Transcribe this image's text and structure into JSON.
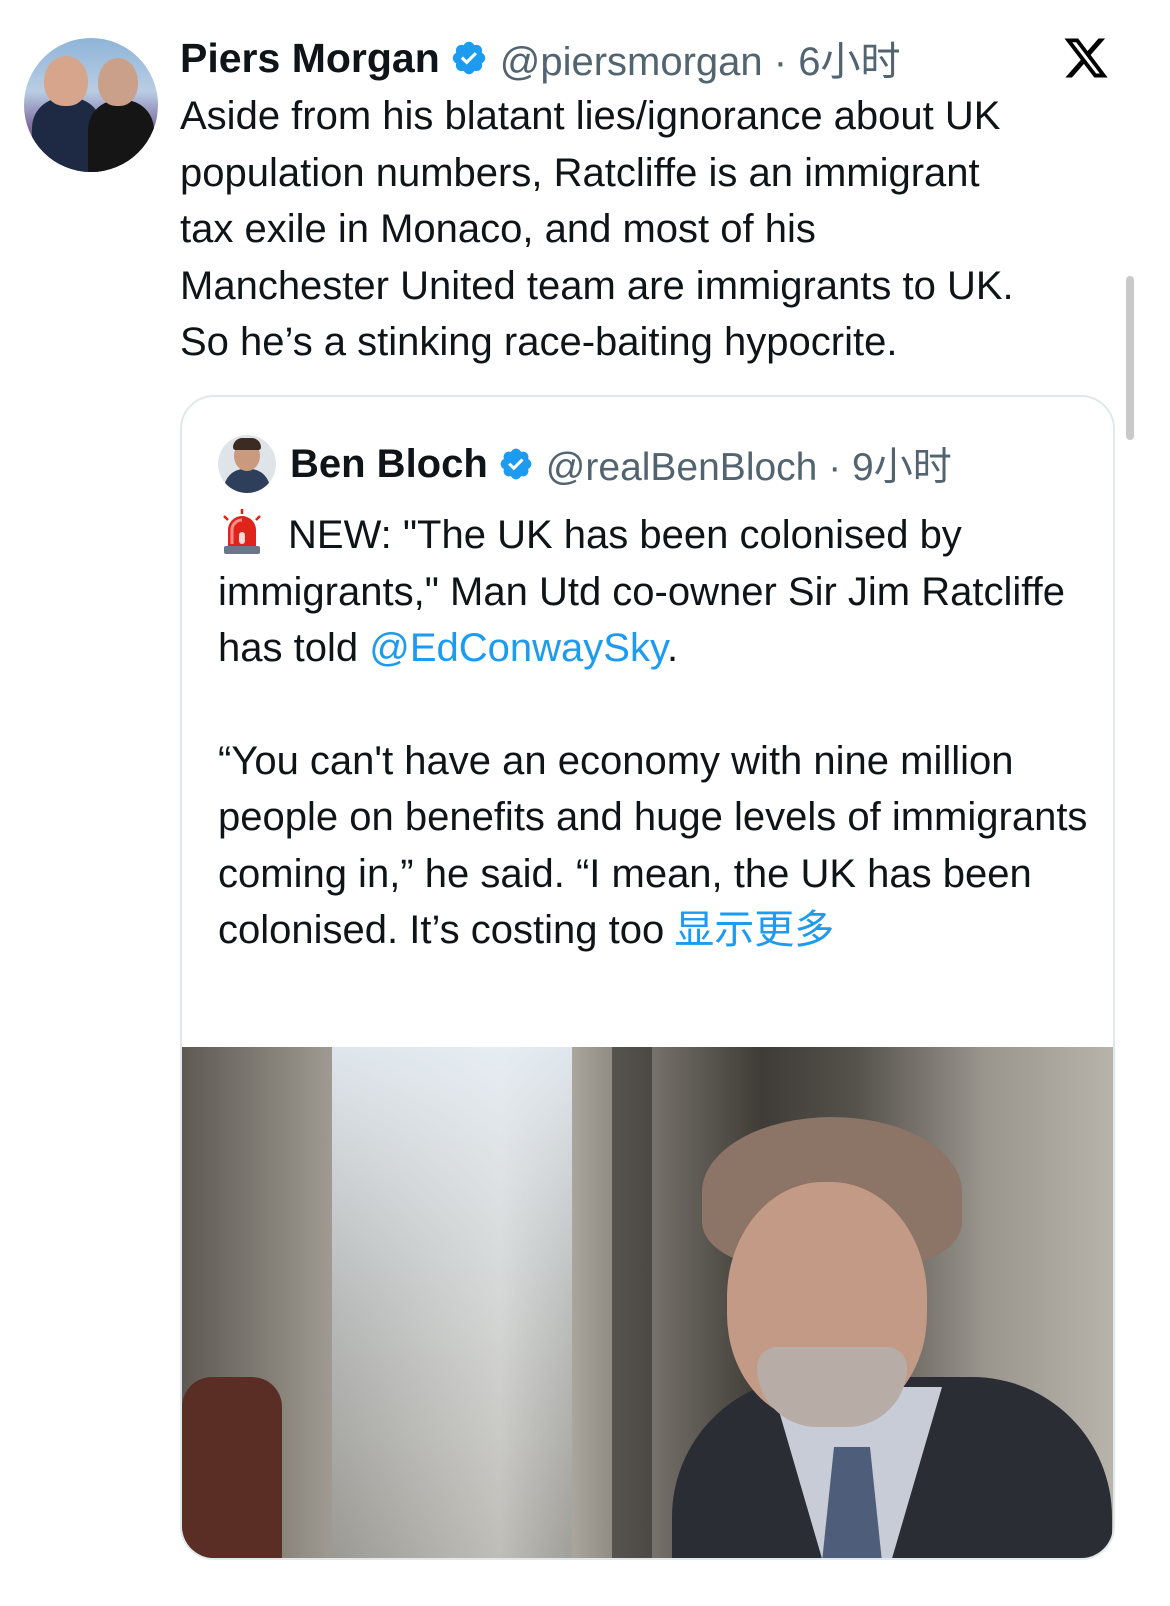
{
  "tweet": {
    "author_name": "Piers Morgan",
    "handle_time": "@piersmorgan · 6小时",
    "text": "Aside from his blatant lies/ignorance about UK\npopulation numbers, Ratcliffe is an immigrant\ntax exile in Monaco, and most of his\nManchester United team are immigrants to UK.\nSo he’s a stinking race-baiting hypocrite.",
    "verified_icon": "verified-badge-icon",
    "brand_icon": "x-logo-icon",
    "accent_color": "#1d9bf0"
  },
  "quote": {
    "author_name": "Ben Bloch",
    "handle_time": "@realBenBloch · 9小时",
    "para1_before": "NEW: \"The UK has been colonised by immigrants,\" Man Utd co-owner Sir Jim Ratcliffe has told ",
    "mention": "@EdConwaySky",
    "para1_after": ".",
    "para2": "“You can't have an economy with nine million people on benefits and huge levels of immigrants coming in,” he said. “I mean, the UK has been colonised. It’s costing too",
    "show_more": "显示更多",
    "siren_icon": "police-siren-icon"
  }
}
